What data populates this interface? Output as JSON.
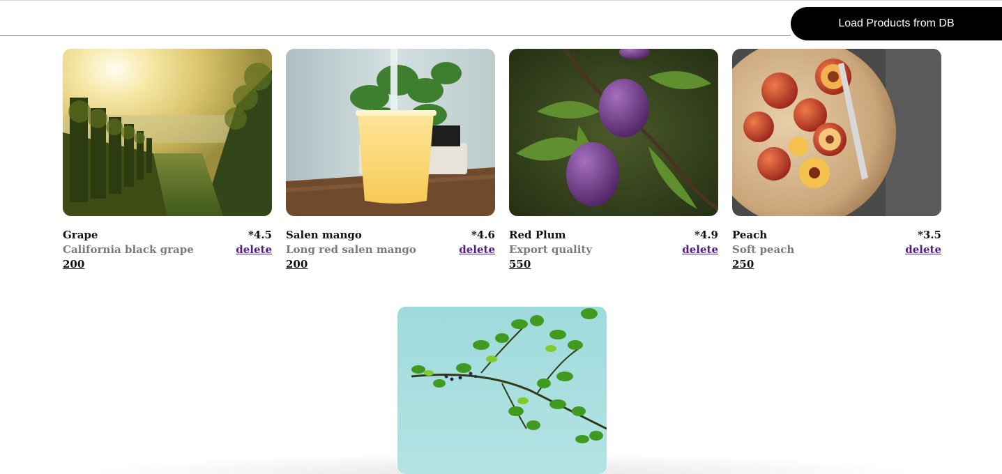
{
  "header": {
    "search_value": "",
    "load_button_label": "Load Products from DB"
  },
  "products": [
    {
      "name": "Grape",
      "description": "California black grape",
      "price": "200",
      "rating": "*4.5",
      "delete_label": "delete",
      "image": "vineyard-photo"
    },
    {
      "name": "Salen mango",
      "description": "Long red salen mango",
      "price": "200",
      "rating": "*4.6",
      "delete_label": "delete",
      "image": "mango-smoothie-photo"
    },
    {
      "name": "Red Plum",
      "description": "Export quality",
      "price": "550",
      "rating": "*4.9",
      "delete_label": "delete",
      "image": "plum-branch-photo"
    },
    {
      "name": "Peach",
      "description": "Soft peach",
      "price": "250",
      "rating": "*3.5",
      "delete_label": "delete",
      "image": "peach-bowl-photo"
    }
  ],
  "fifth_product": {
    "image": "leafy-branch-photo"
  },
  "colors": {
    "button_bg": "#000000",
    "link": "#551a8b",
    "muted_text": "#7a7a7a"
  }
}
